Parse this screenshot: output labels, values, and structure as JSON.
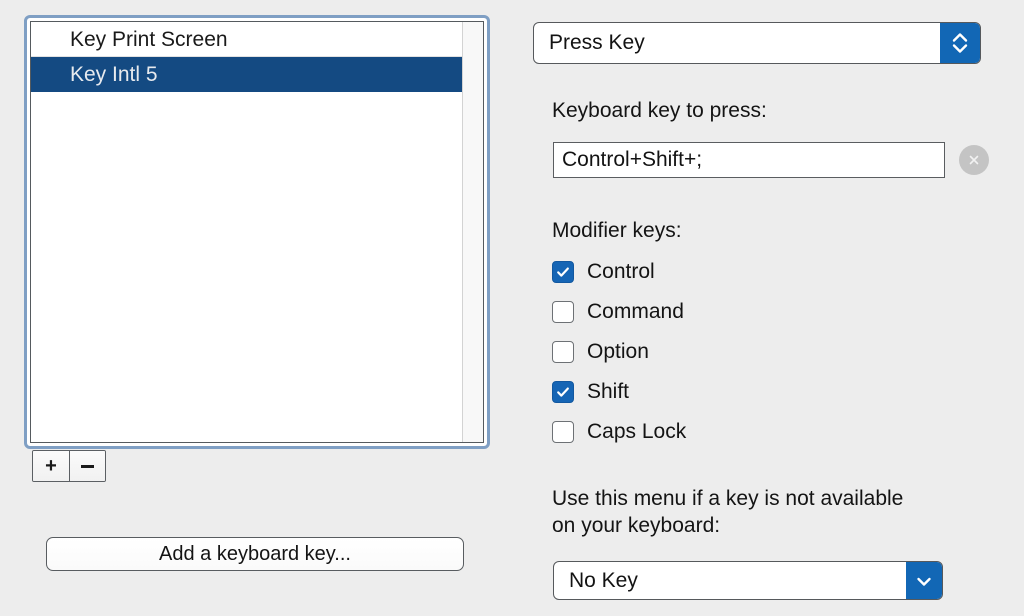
{
  "key_list": {
    "items": [
      {
        "label": "Key Print Screen",
        "selected": false
      },
      {
        "label": "Key Intl 5",
        "selected": true
      }
    ],
    "add_button_label": "+",
    "remove_button_label": "-",
    "add_keyboard_key_label": "Add a keyboard key..."
  },
  "action_popup": {
    "selected_value": "Press Key"
  },
  "key_to_press": {
    "label": "Keyboard key to press:",
    "value": "Control+Shift+;",
    "placeholder": "",
    "clear_icon": "clear-circle-icon"
  },
  "modifiers": {
    "label": "Modifier keys:",
    "items": [
      {
        "label": "Control",
        "checked": true
      },
      {
        "label": "Command",
        "checked": false
      },
      {
        "label": "Option",
        "checked": false
      },
      {
        "label": "Shift",
        "checked": true
      },
      {
        "label": "Caps Lock",
        "checked": false
      }
    ]
  },
  "fallback_menu": {
    "help_text": "Use this menu if a key is not available on your keyboard:",
    "selected_value": "No Key"
  },
  "colors": {
    "window_background": "#ededed",
    "selection_blue": "#144a82",
    "accent_blue": "#1267b5",
    "checkbox_blue": "#1565b5",
    "focus_ring": "#7f9fc4"
  }
}
